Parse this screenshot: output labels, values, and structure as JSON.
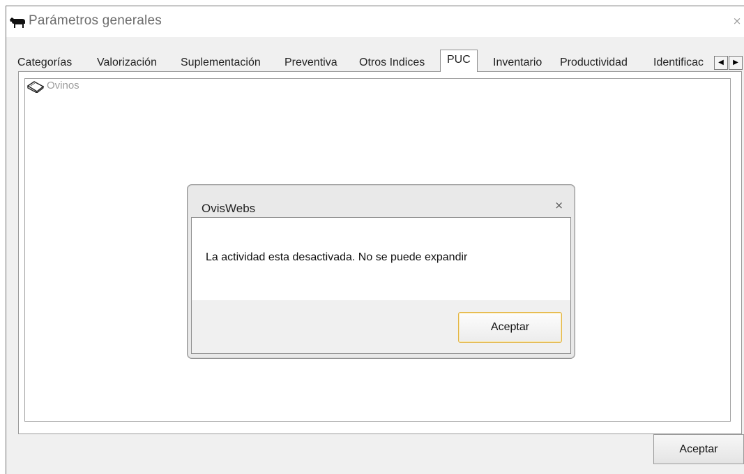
{
  "window": {
    "title": "Parámetros generales",
    "close_glyph": "⨯"
  },
  "tabs": [
    {
      "label": "Categorías"
    },
    {
      "label": "Valorización"
    },
    {
      "label": "Suplementación"
    },
    {
      "label": "Preventiva"
    },
    {
      "label": "Otros Indices"
    },
    {
      "label": "PUC",
      "selected": true
    },
    {
      "label": "Inventario"
    },
    {
      "label": "Productividad"
    },
    {
      "label": "Identificac"
    }
  ],
  "tab_scroll": {
    "left_glyph": "◀",
    "right_glyph": "▶"
  },
  "tree": {
    "root_label": "Ovinos",
    "root_icon": "book-icon"
  },
  "footer": {
    "ok_label": "Aceptar"
  },
  "dialog": {
    "title": "OvisWebs",
    "close_glyph": "⨯",
    "message": "La actividad esta desactivada. No se puede expandir",
    "ok_label": "Aceptar"
  },
  "icons": {
    "app": "sheep-icon",
    "tree_node": "book-icon"
  },
  "colors": {
    "window_bg": "#f0f0f0",
    "focus_border": "#e3b545"
  }
}
